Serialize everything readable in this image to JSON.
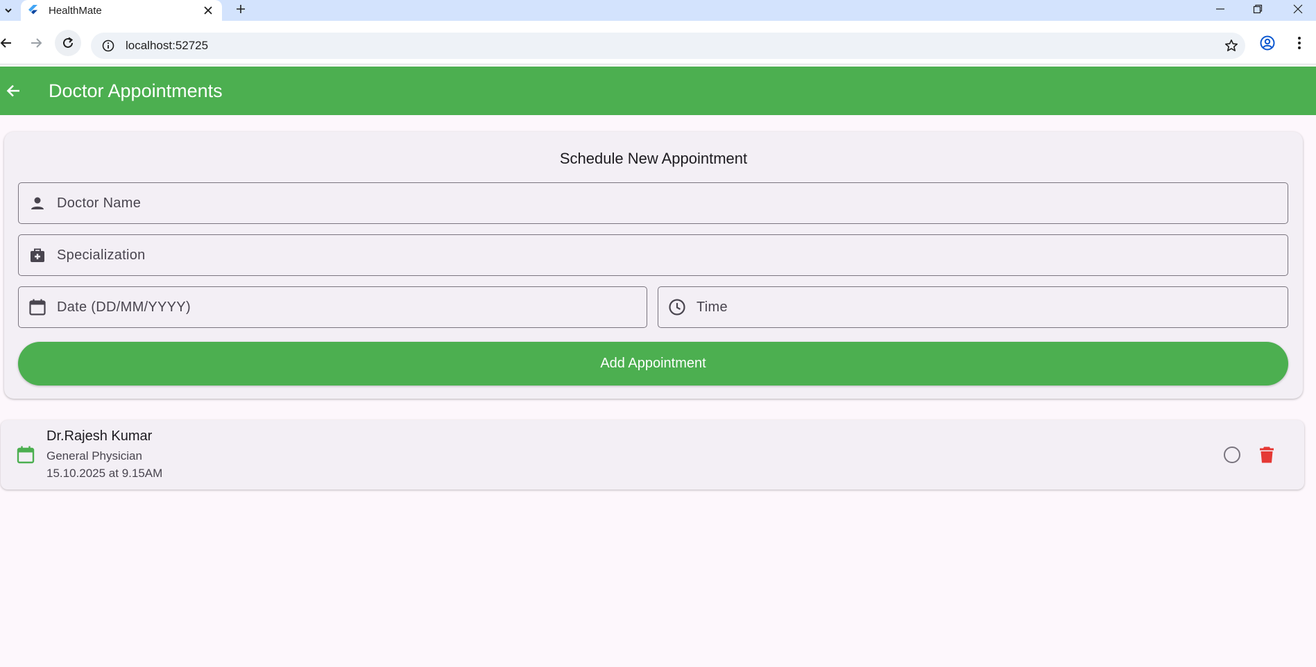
{
  "browser": {
    "tab_title": "HealthMate",
    "url": "localhost:52725"
  },
  "appbar": {
    "title": "Doctor Appointments"
  },
  "form": {
    "title": "Schedule New Appointment",
    "doctor_name": {
      "placeholder": "Doctor Name",
      "value": ""
    },
    "specialization": {
      "placeholder": "Specialization",
      "value": ""
    },
    "date": {
      "placeholder": "Date (DD/MM/YYYY)",
      "value": ""
    },
    "time": {
      "placeholder": "Time",
      "value": ""
    },
    "submit_label": "Add Appointment"
  },
  "appointments": [
    {
      "doctor": "Dr.Rajesh Kumar",
      "specialization": "General Physician",
      "when": "15.10.2025 at 9.15AM",
      "completed": false
    }
  ],
  "colors": {
    "primary": "#4caf50",
    "background": "#fdf7fc",
    "card": "#f3eff5",
    "delete": "#e53935",
    "tabstrip": "#d3e3fd"
  },
  "icons": {
    "back": "arrow-left-icon",
    "doctor_field": "person-icon",
    "specialization_field": "medical-bag-icon",
    "date_field": "calendar-icon",
    "time_field": "clock-icon",
    "appointment": "calendar-icon",
    "complete": "circle-outline-icon",
    "delete": "trash-icon"
  }
}
